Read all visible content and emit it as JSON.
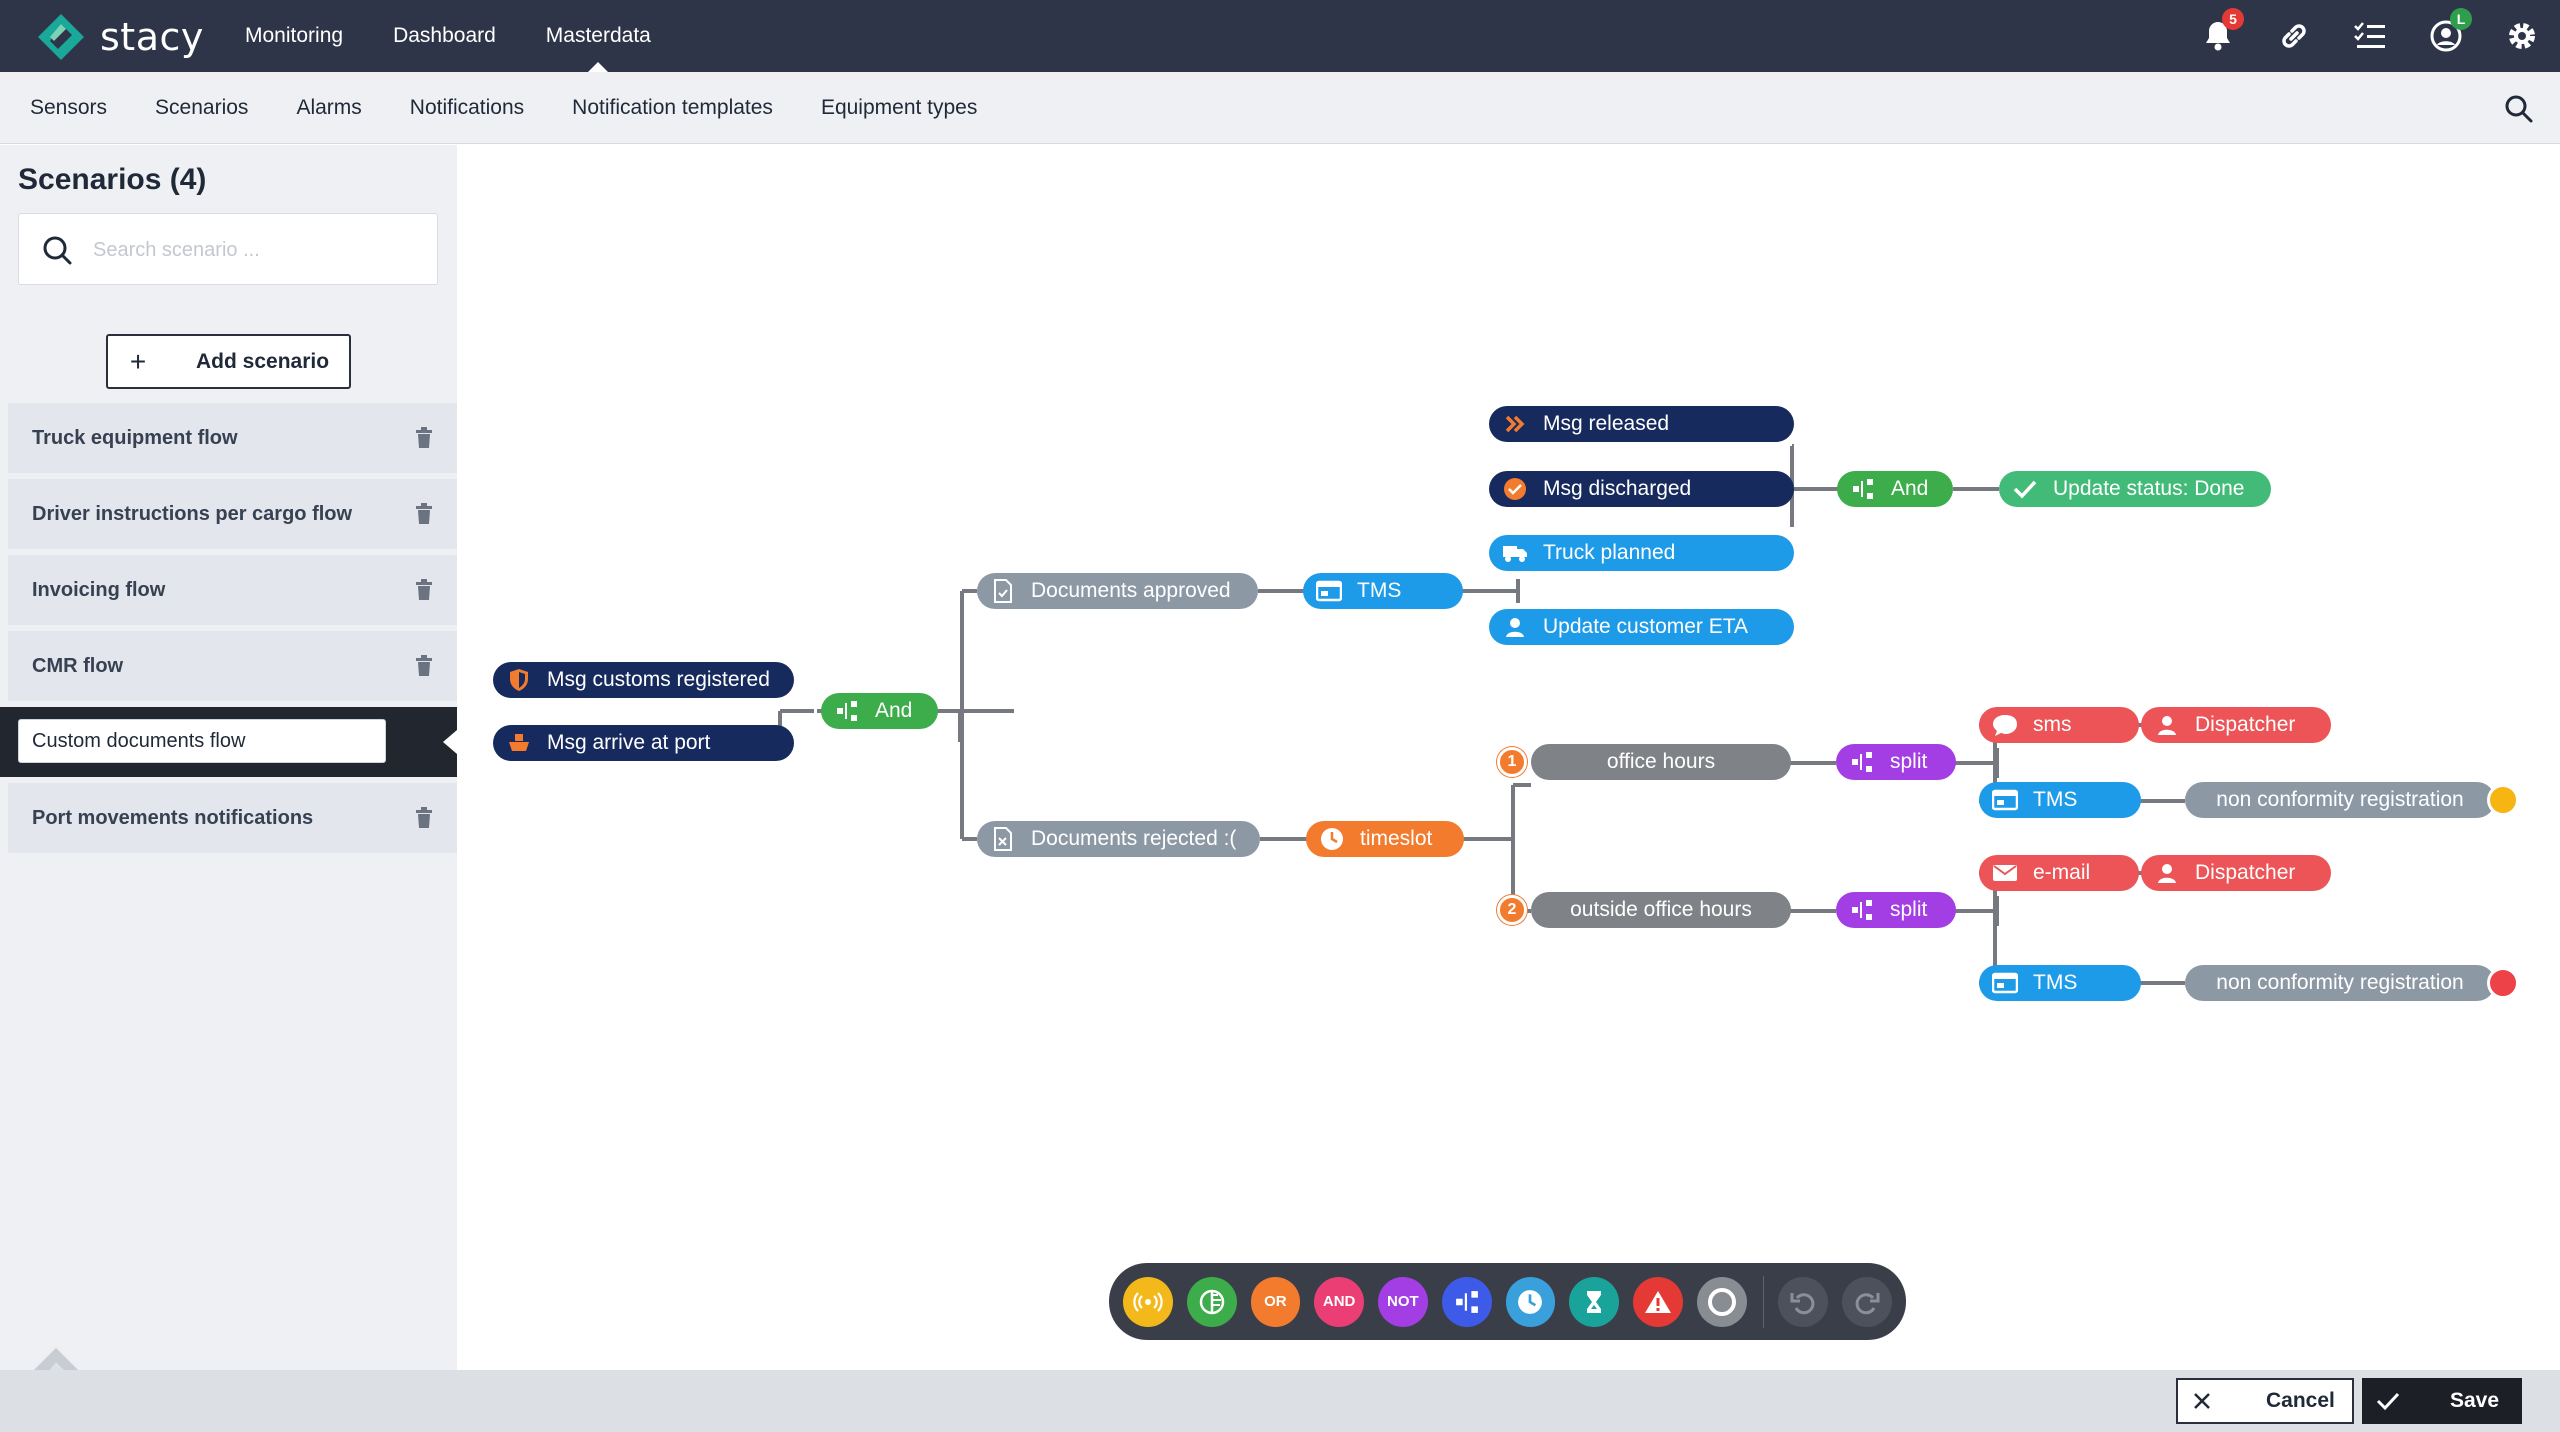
{
  "app": {
    "name": "stacy"
  },
  "mainnav": [
    {
      "label": "Monitoring"
    },
    {
      "label": "Dashboard"
    },
    {
      "label": "Masterdata",
      "active": true
    }
  ],
  "topicons": {
    "notifications_badge": "5",
    "profile_badge": "L"
  },
  "subnav": [
    {
      "label": "Sensors"
    },
    {
      "label": "Scenarios"
    },
    {
      "label": "Alarms"
    },
    {
      "label": "Notifications"
    },
    {
      "label": "Notification templates"
    },
    {
      "label": "Equipment types"
    }
  ],
  "sidebar": {
    "title": "Scenarios (4)",
    "search_placeholder": "Search scenario ...",
    "add_label": "Add scenario",
    "items": [
      {
        "label": "Truck equipment flow"
      },
      {
        "label": "Driver instructions per cargo flow"
      },
      {
        "label": "Invoicing flow"
      },
      {
        "label": "CMR flow"
      },
      {
        "label": "Custom documents flow",
        "active": true
      },
      {
        "label": "Port movements notifications"
      }
    ]
  },
  "flow": {
    "nodes": {
      "msg_customs": "Msg customs registered",
      "msg_arrive": "Msg arrive at port",
      "and1": "And",
      "docs_approved": "Documents approved",
      "tms1": "TMS",
      "msg_released": "Msg released",
      "msg_discharged": "Msg discharged",
      "truck_planned": "Truck planned",
      "update_eta": "Update customer ETA",
      "and2": "And",
      "update_status": "Update status: Done",
      "docs_rejected": "Documents rejected :(",
      "timeslot": "timeslot",
      "office_hours": "office hours",
      "outside_hours": "outside office hours",
      "split1": "split",
      "split2": "split",
      "sms": "sms",
      "dispatcher1": "Dispatcher",
      "tms2": "TMS",
      "ncr1": "non conformity registration",
      "email": "e-mail",
      "dispatcher2": "Dispatcher",
      "tms3": "TMS",
      "ncr2": "non conformity registration",
      "badge1": "1",
      "badge2": "2"
    },
    "status_colors": {
      "ncr1": "#f6b511",
      "ncr2": "#ec4248"
    }
  },
  "palette": [
    {
      "name": "sensor-tool",
      "label": "",
      "color": "#f3b81a"
    },
    {
      "name": "condition-tool",
      "label": "",
      "color": "#3cad4a"
    },
    {
      "name": "or-tool",
      "label": "OR",
      "color": "#f27b2e"
    },
    {
      "name": "and-tool",
      "label": "AND",
      "color": "#ea3e74"
    },
    {
      "name": "not-tool",
      "label": "NOT",
      "color": "#a23ee3"
    },
    {
      "name": "split-tool",
      "label": "",
      "color": "#3d5be8"
    },
    {
      "name": "timeslot-tool",
      "label": "",
      "color": "#3aa0dc"
    },
    {
      "name": "timer-tool",
      "label": "",
      "color": "#1aa39b"
    },
    {
      "name": "alarm-tool",
      "label": "",
      "color": "#e53935"
    },
    {
      "name": "end-tool",
      "label": "",
      "color": "#888c93"
    }
  ],
  "footer": {
    "cancel_label": "Cancel",
    "save_label": "Save"
  }
}
